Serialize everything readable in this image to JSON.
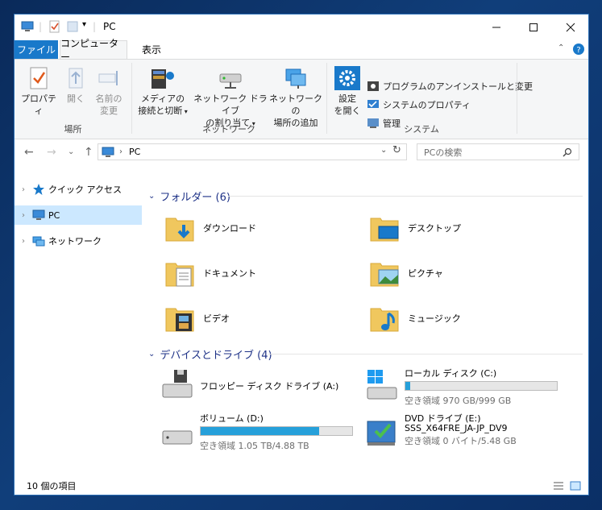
{
  "window": {
    "title": "PC"
  },
  "tabs": {
    "file": "ファイル",
    "computer": "コンピューター",
    "view": "表示"
  },
  "ribbon": {
    "location": {
      "label": "場所",
      "properties": "プロパティ",
      "open": "開く",
      "rename_line1": "名前の",
      "rename_line2": "変更"
    },
    "network": {
      "label": "ネットワーク",
      "media_line1": "メディアの",
      "media_line2": "接続と切断",
      "map_line1": "ネットワーク ドライブ",
      "map_line2": "の割り当て",
      "add_line1": "ネットワークの",
      "add_line2": "場所の追加"
    },
    "system": {
      "label": "システム",
      "settings_line1": "設定",
      "settings_line2": "を開く",
      "uninstall": "プログラムのアンインストールと変更",
      "sysprops": "システムのプロパティ",
      "manage": "管理"
    }
  },
  "address": {
    "path": "PC",
    "search_placeholder": "PCの検索"
  },
  "nav": {
    "items": [
      {
        "label": "クイック アクセス"
      },
      {
        "label": "PC"
      },
      {
        "label": "ネットワーク"
      }
    ]
  },
  "folders": {
    "header": "フォルダー (6)",
    "items": [
      {
        "label": "ダウンロード",
        "icon": "downloads-folder-icon"
      },
      {
        "label": "デスクトップ",
        "icon": "desktop-folder-icon"
      },
      {
        "label": "ドキュメント",
        "icon": "documents-folder-icon"
      },
      {
        "label": "ピクチャ",
        "icon": "pictures-folder-icon"
      },
      {
        "label": "ビデオ",
        "icon": "videos-folder-icon"
      },
      {
        "label": "ミュージック",
        "icon": "music-folder-icon"
      }
    ]
  },
  "drives": {
    "header": "デバイスとドライブ (4)",
    "items": [
      {
        "label": "フロッピー ディスク ドライブ (A:)"
      },
      {
        "label": "ローカル ディスク (C:)",
        "free": "空き領域 970 GB/999 GB",
        "used_fraction": 0.03
      },
      {
        "label": "ボリューム (D:)",
        "free": "空き領域 1.05 TB/4.88 TB",
        "used_fraction": 0.78
      },
      {
        "label": "DVD ドライブ (E:)",
        "label2": "SSS_X64FRE_JA-JP_DV9",
        "free": "空き領域 0 バイト/5.48 GB"
      }
    ]
  },
  "status": {
    "count": "10 個の項目"
  },
  "colors": {
    "accent": "#1979ca",
    "selection": "#cce8ff",
    "drive_bar": "#26a0da",
    "section_header": "#1e3287"
  }
}
